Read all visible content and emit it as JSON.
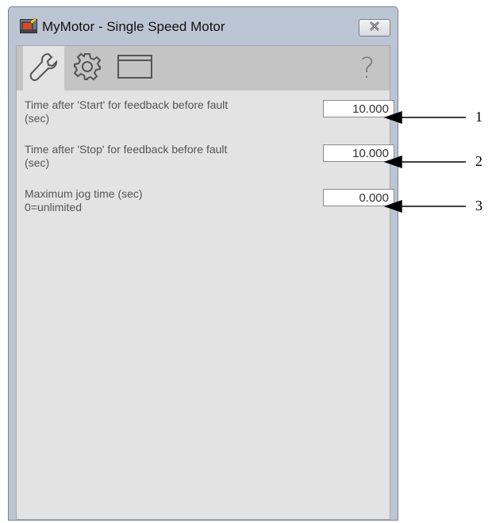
{
  "window": {
    "title": "MyMotor - Single Speed Motor"
  },
  "toolbar": {
    "tabs": [
      {
        "icon": "wrench-icon",
        "selected": true
      },
      {
        "icon": "gear-icon",
        "selected": false
      },
      {
        "icon": "window-icon",
        "selected": false
      }
    ],
    "help_glyph": "?"
  },
  "parameters": [
    {
      "label_line1": "Time after 'Start' for feedback before fault",
      "label_line2": "(sec)",
      "value": "10.000"
    },
    {
      "label_line1": "Time after 'Stop' for feedback before fault",
      "label_line2": "(sec)",
      "value": "10.000"
    },
    {
      "label_line1": "Maximum jog time (sec)",
      "label_line2": "0=unlimited",
      "value": "0.000"
    }
  ],
  "callouts": [
    "1",
    "2",
    "3"
  ]
}
